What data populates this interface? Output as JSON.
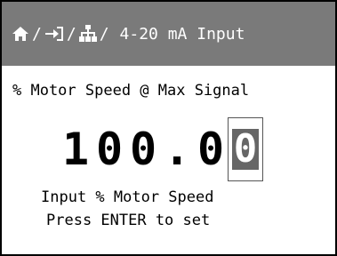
{
  "header": {
    "title": "4-20 mA Input",
    "separator": "/",
    "icons": [
      "home-icon",
      "input-arrow-icon",
      "settings-tree-icon"
    ],
    "background": "#7a7a7a",
    "text_color": "#ffffff"
  },
  "parameter": {
    "label": "% Motor Speed @ Max Signal"
  },
  "value": {
    "digits": [
      "1",
      "0",
      "0",
      ".",
      "0"
    ],
    "selected_digit": "0"
  },
  "help": {
    "line1": "Input % Motor Speed",
    "line2": "Press ENTER to set"
  }
}
